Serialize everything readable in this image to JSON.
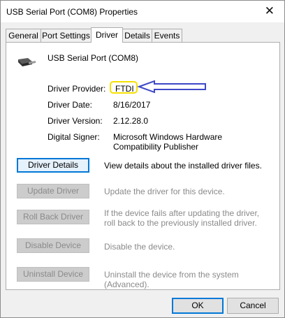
{
  "window": {
    "title": "USB Serial Port (COM8) Properties",
    "close_icon": "close-icon"
  },
  "tabs": [
    {
      "label": "General",
      "active": false
    },
    {
      "label": "Port Settings",
      "active": false
    },
    {
      "label": "Driver",
      "active": true
    },
    {
      "label": "Details",
      "active": false
    },
    {
      "label": "Events",
      "active": false
    }
  ],
  "device": {
    "name": "USB Serial Port (COM8)",
    "icon": "usb-connector-icon"
  },
  "info": {
    "provider_label": "Driver Provider:",
    "provider_value": "FTDI",
    "date_label": "Driver Date:",
    "date_value": "8/16/2017",
    "version_label": "Driver Version:",
    "version_value": "2.12.28.0",
    "signer_label": "Digital Signer:",
    "signer_value": "Microsoft Windows Hardware Compatibility Publisher"
  },
  "annotation": {
    "highlight_color": "#f5e000",
    "arrow_color": "#3e48c8"
  },
  "actions": [
    {
      "label": "Driver Details",
      "description": "View details about the installed driver files.",
      "enabled": true
    },
    {
      "label": "Update Driver",
      "description": "Update the driver for this device.",
      "enabled": false
    },
    {
      "label": "Roll Back Driver",
      "description": "If the device fails after updating the driver, roll back to the previously installed driver.",
      "enabled": false
    },
    {
      "label": "Disable Device",
      "description": "Disable the device.",
      "enabled": false
    },
    {
      "label": "Uninstall Device",
      "description": "Uninstall the device from the system (Advanced).",
      "enabled": false
    }
  ],
  "footer": {
    "ok_label": "OK",
    "cancel_label": "Cancel"
  }
}
